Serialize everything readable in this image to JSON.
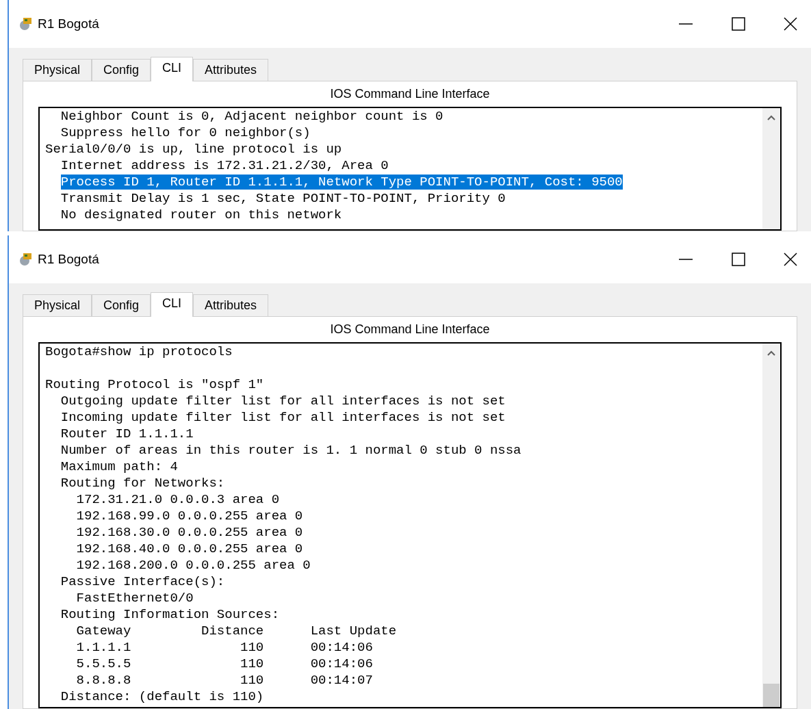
{
  "windows": [
    {
      "title": "R1 Bogotá",
      "tabs": [
        {
          "label": "Physical",
          "selected": false
        },
        {
          "label": "Config",
          "selected": false
        },
        {
          "label": "CLI",
          "selected": true
        },
        {
          "label": "Attributes",
          "selected": false
        }
      ],
      "panel_title": "IOS Command Line Interface",
      "console_lines": [
        {
          "text": "  Neighbor Count is 0, Adjacent neighbor count is 0",
          "selected": false
        },
        {
          "text": "  Suppress hello for 0 neighbor(s)",
          "selected": false
        },
        {
          "text": "Serial0/0/0 is up, line protocol is up",
          "selected": false
        },
        {
          "text": "  Internet address is 172.31.21.2/30, Area 0",
          "selected": false
        },
        {
          "text": "  Process ID 1, Router ID 1.1.1.1, Network Type POINT-TO-POINT, Cost: 9500",
          "selected": true
        },
        {
          "text": "  Transmit Delay is 1 sec, State POINT-TO-POINT, Priority 0",
          "selected": false
        },
        {
          "text": "  No designated router on this network",
          "selected": false
        }
      ]
    },
    {
      "title": "R1 Bogotá",
      "tabs": [
        {
          "label": "Physical",
          "selected": false
        },
        {
          "label": "Config",
          "selected": false
        },
        {
          "label": "CLI",
          "selected": true
        },
        {
          "label": "Attributes",
          "selected": false
        }
      ],
      "panel_title": "IOS Command Line Interface",
      "console_lines": [
        {
          "text": "Bogota#show ip protocols",
          "selected": false
        },
        {
          "text": "Routing Protocol is \"ospf 1\"",
          "selected": false,
          "gap_before": true
        },
        {
          "text": "  Outgoing update filter list for all interfaces is not set",
          "selected": false
        },
        {
          "text": "  Incoming update filter list for all interfaces is not set",
          "selected": false
        },
        {
          "text": "  Router ID 1.1.1.1",
          "selected": false
        },
        {
          "text": "  Number of areas in this router is 1. 1 normal 0 stub 0 nssa",
          "selected": false
        },
        {
          "text": "  Maximum path: 4",
          "selected": false
        },
        {
          "text": "  Routing for Networks:",
          "selected": false
        },
        {
          "text": "    172.31.21.0 0.0.0.3 area 0",
          "selected": false
        },
        {
          "text": "    192.168.99.0 0.0.0.255 area 0",
          "selected": false
        },
        {
          "text": "    192.168.30.0 0.0.0.255 area 0",
          "selected": false
        },
        {
          "text": "    192.168.40.0 0.0.0.255 area 0",
          "selected": false
        },
        {
          "text": "    192.168.200.0 0.0.0.255 area 0",
          "selected": false
        },
        {
          "text": "  Passive Interface(s):",
          "selected": false
        },
        {
          "text": "    FastEthernet0/0",
          "selected": false
        },
        {
          "text": "  Routing Information Sources:",
          "selected": false
        },
        {
          "text": "    Gateway         Distance      Last Update",
          "selected": false
        },
        {
          "text": "    1.1.1.1              110      00:14:06",
          "selected": false
        },
        {
          "text": "    5.5.5.5              110      00:14:06",
          "selected": false
        },
        {
          "text": "    8.8.8.8              110      00:14:07",
          "selected": false
        },
        {
          "text": "  Distance: (default is 110)",
          "selected": false
        }
      ]
    }
  ]
}
